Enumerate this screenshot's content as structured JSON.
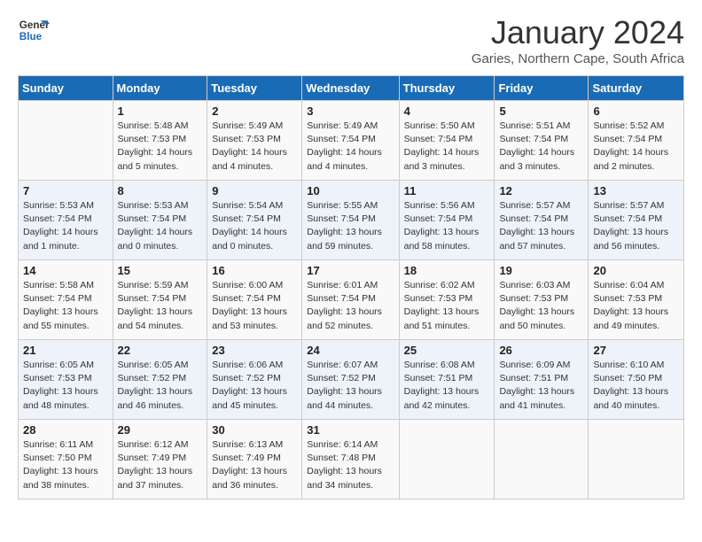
{
  "logo": {
    "line1": "General",
    "line2": "Blue"
  },
  "title": "January 2024",
  "subtitle": "Garies, Northern Cape, South Africa",
  "days_of_week": [
    "Sunday",
    "Monday",
    "Tuesday",
    "Wednesday",
    "Thursday",
    "Friday",
    "Saturday"
  ],
  "weeks": [
    [
      {
        "num": "",
        "info": ""
      },
      {
        "num": "1",
        "info": "Sunrise: 5:48 AM\nSunset: 7:53 PM\nDaylight: 14 hours\nand 5 minutes."
      },
      {
        "num": "2",
        "info": "Sunrise: 5:49 AM\nSunset: 7:53 PM\nDaylight: 14 hours\nand 4 minutes."
      },
      {
        "num": "3",
        "info": "Sunrise: 5:49 AM\nSunset: 7:54 PM\nDaylight: 14 hours\nand 4 minutes."
      },
      {
        "num": "4",
        "info": "Sunrise: 5:50 AM\nSunset: 7:54 PM\nDaylight: 14 hours\nand 3 minutes."
      },
      {
        "num": "5",
        "info": "Sunrise: 5:51 AM\nSunset: 7:54 PM\nDaylight: 14 hours\nand 3 minutes."
      },
      {
        "num": "6",
        "info": "Sunrise: 5:52 AM\nSunset: 7:54 PM\nDaylight: 14 hours\nand 2 minutes."
      }
    ],
    [
      {
        "num": "7",
        "info": "Sunrise: 5:53 AM\nSunset: 7:54 PM\nDaylight: 14 hours\nand 1 minute."
      },
      {
        "num": "8",
        "info": "Sunrise: 5:53 AM\nSunset: 7:54 PM\nDaylight: 14 hours\nand 0 minutes."
      },
      {
        "num": "9",
        "info": "Sunrise: 5:54 AM\nSunset: 7:54 PM\nDaylight: 14 hours\nand 0 minutes."
      },
      {
        "num": "10",
        "info": "Sunrise: 5:55 AM\nSunset: 7:54 PM\nDaylight: 13 hours\nand 59 minutes."
      },
      {
        "num": "11",
        "info": "Sunrise: 5:56 AM\nSunset: 7:54 PM\nDaylight: 13 hours\nand 58 minutes."
      },
      {
        "num": "12",
        "info": "Sunrise: 5:57 AM\nSunset: 7:54 PM\nDaylight: 13 hours\nand 57 minutes."
      },
      {
        "num": "13",
        "info": "Sunrise: 5:57 AM\nSunset: 7:54 PM\nDaylight: 13 hours\nand 56 minutes."
      }
    ],
    [
      {
        "num": "14",
        "info": "Sunrise: 5:58 AM\nSunset: 7:54 PM\nDaylight: 13 hours\nand 55 minutes."
      },
      {
        "num": "15",
        "info": "Sunrise: 5:59 AM\nSunset: 7:54 PM\nDaylight: 13 hours\nand 54 minutes."
      },
      {
        "num": "16",
        "info": "Sunrise: 6:00 AM\nSunset: 7:54 PM\nDaylight: 13 hours\nand 53 minutes."
      },
      {
        "num": "17",
        "info": "Sunrise: 6:01 AM\nSunset: 7:54 PM\nDaylight: 13 hours\nand 52 minutes."
      },
      {
        "num": "18",
        "info": "Sunrise: 6:02 AM\nSunset: 7:53 PM\nDaylight: 13 hours\nand 51 minutes."
      },
      {
        "num": "19",
        "info": "Sunrise: 6:03 AM\nSunset: 7:53 PM\nDaylight: 13 hours\nand 50 minutes."
      },
      {
        "num": "20",
        "info": "Sunrise: 6:04 AM\nSunset: 7:53 PM\nDaylight: 13 hours\nand 49 minutes."
      }
    ],
    [
      {
        "num": "21",
        "info": "Sunrise: 6:05 AM\nSunset: 7:53 PM\nDaylight: 13 hours\nand 48 minutes."
      },
      {
        "num": "22",
        "info": "Sunrise: 6:05 AM\nSunset: 7:52 PM\nDaylight: 13 hours\nand 46 minutes."
      },
      {
        "num": "23",
        "info": "Sunrise: 6:06 AM\nSunset: 7:52 PM\nDaylight: 13 hours\nand 45 minutes."
      },
      {
        "num": "24",
        "info": "Sunrise: 6:07 AM\nSunset: 7:52 PM\nDaylight: 13 hours\nand 44 minutes."
      },
      {
        "num": "25",
        "info": "Sunrise: 6:08 AM\nSunset: 7:51 PM\nDaylight: 13 hours\nand 42 minutes."
      },
      {
        "num": "26",
        "info": "Sunrise: 6:09 AM\nSunset: 7:51 PM\nDaylight: 13 hours\nand 41 minutes."
      },
      {
        "num": "27",
        "info": "Sunrise: 6:10 AM\nSunset: 7:50 PM\nDaylight: 13 hours\nand 40 minutes."
      }
    ],
    [
      {
        "num": "28",
        "info": "Sunrise: 6:11 AM\nSunset: 7:50 PM\nDaylight: 13 hours\nand 38 minutes."
      },
      {
        "num": "29",
        "info": "Sunrise: 6:12 AM\nSunset: 7:49 PM\nDaylight: 13 hours\nand 37 minutes."
      },
      {
        "num": "30",
        "info": "Sunrise: 6:13 AM\nSunset: 7:49 PM\nDaylight: 13 hours\nand 36 minutes."
      },
      {
        "num": "31",
        "info": "Sunrise: 6:14 AM\nSunset: 7:48 PM\nDaylight: 13 hours\nand 34 minutes."
      },
      {
        "num": "",
        "info": ""
      },
      {
        "num": "",
        "info": ""
      },
      {
        "num": "",
        "info": ""
      }
    ]
  ]
}
